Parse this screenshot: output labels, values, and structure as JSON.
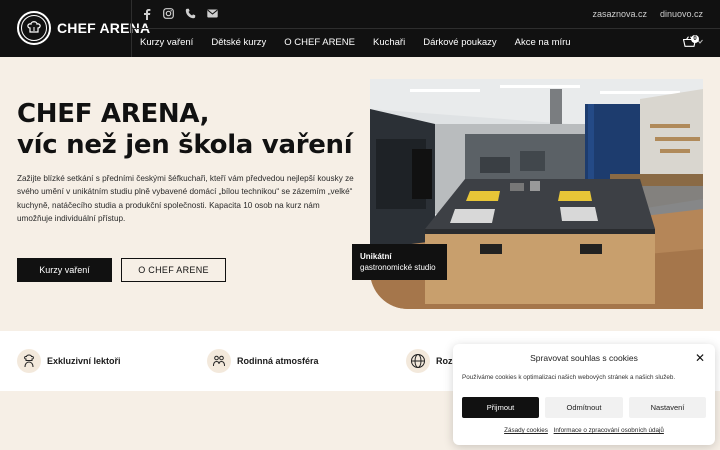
{
  "brand": {
    "name": "CHEF ARENA"
  },
  "top_links": [
    "zasaznova.cz",
    "dinuovo.cz"
  ],
  "social_icons": [
    "facebook-icon",
    "instagram-icon",
    "phone-icon",
    "mail-icon"
  ],
  "nav": {
    "items": [
      "Kurzy vaření",
      "Dětské kurzy",
      "O CHEF ARENE",
      "Kuchaři",
      "Dárkové poukazy",
      "Akce na míru"
    ]
  },
  "cart": {
    "count": "0"
  },
  "hero": {
    "title_line1": "CHEF ARENA,",
    "title_line2": "víc než jen škola vaření",
    "text": "Zažijte blízké setkání s předními českými šéfkuchaři, kteří vám předvedou nejlepší kousky ze svého umění v unikátním studiu plně vybavené domácí „bílou technikou“ se zázemím „velké“ kuchyně, natáčecího studia a produkční společnosti. Kapacita 10 osob na kurz nám umožňuje individuální přístup.",
    "btn_primary": "Kurzy vaření",
    "btn_secondary": "O CHEF ARENE",
    "badge_bold": "Unikátní",
    "badge_text": "gastronomické studio"
  },
  "features": [
    {
      "icon": "chef-icon",
      "label": "Exkluzivní lektoři"
    },
    {
      "icon": "family-icon",
      "label": "Rodinná atmosféra"
    },
    {
      "icon": "globe-icon",
      "label": "Rozm"
    }
  ],
  "cookie": {
    "title": "Spravovat souhlas s cookies",
    "text": "Používáme cookies k optimalizaci našich webových stránek a našich služeb.",
    "accept": "Přijmout",
    "deny": "Odmítnout",
    "prefs": "Nastavení",
    "link1": "Zásady cookies",
    "link2": "Informace o zpracování osobních údajů"
  },
  "colors": {
    "header": "#111111",
    "page_bg": "#f6efe6",
    "accent_icon_bg": "#f3e9dc"
  }
}
